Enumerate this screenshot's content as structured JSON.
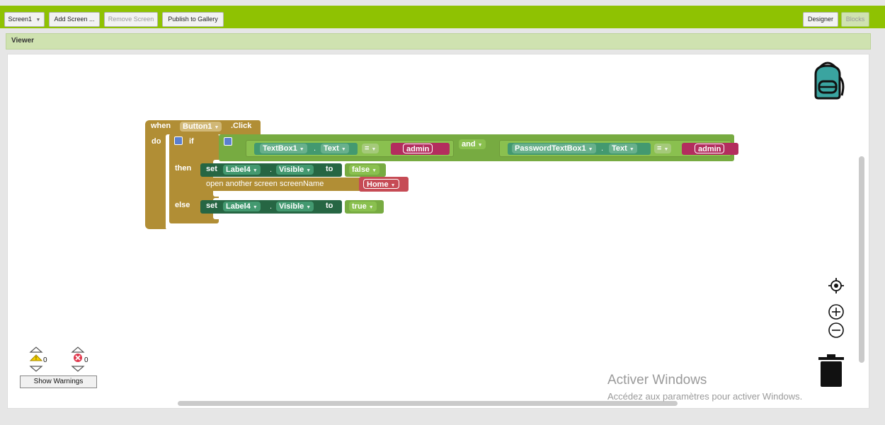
{
  "toolbar": {
    "screen_select": "Screen1",
    "add_screen": "Add Screen ...",
    "remove_screen": "Remove Screen",
    "publish": "Publish to Gallery",
    "designer": "Designer",
    "blocks": "Blocks"
  },
  "viewer": {
    "title": "Viewer"
  },
  "blocks": {
    "when": "when",
    "button": "Button1",
    "click": ".Click",
    "do": "do",
    "if": "if",
    "textbox": "TextBox1",
    "dot": ".",
    "text": "Text",
    "eq": "=",
    "admin1": "admin",
    "and": "and",
    "password": "PasswordTextBox1",
    "text2": "Text",
    "eq2": "=",
    "admin2": "admin",
    "then": "then",
    "set1": "set",
    "label1": "Label4",
    "visible1": "Visible",
    "to1": "to",
    "false": "false",
    "open_screen": "open another screen  screenName",
    "home": "Home",
    "else": "else",
    "set2": "set",
    "label2": "Label4",
    "visible2": "Visible",
    "to2": "to",
    "true": "true"
  },
  "warnings": {
    "warn_count": "0",
    "error_count": "0",
    "show_warnings": "Show Warnings"
  },
  "watermark": {
    "line1": "Activer Windows",
    "line2": "Accédez aux paramètres pour activer Windows."
  },
  "colors": {
    "toolbar": "#8fc202",
    "event": "#b18e35",
    "control": "#b18e35",
    "logic": "#77ab41",
    "component": "#439970",
    "setter": "#266643",
    "text": "#b32d5e",
    "screen": "#b18e35",
    "home": "#c64b55"
  }
}
